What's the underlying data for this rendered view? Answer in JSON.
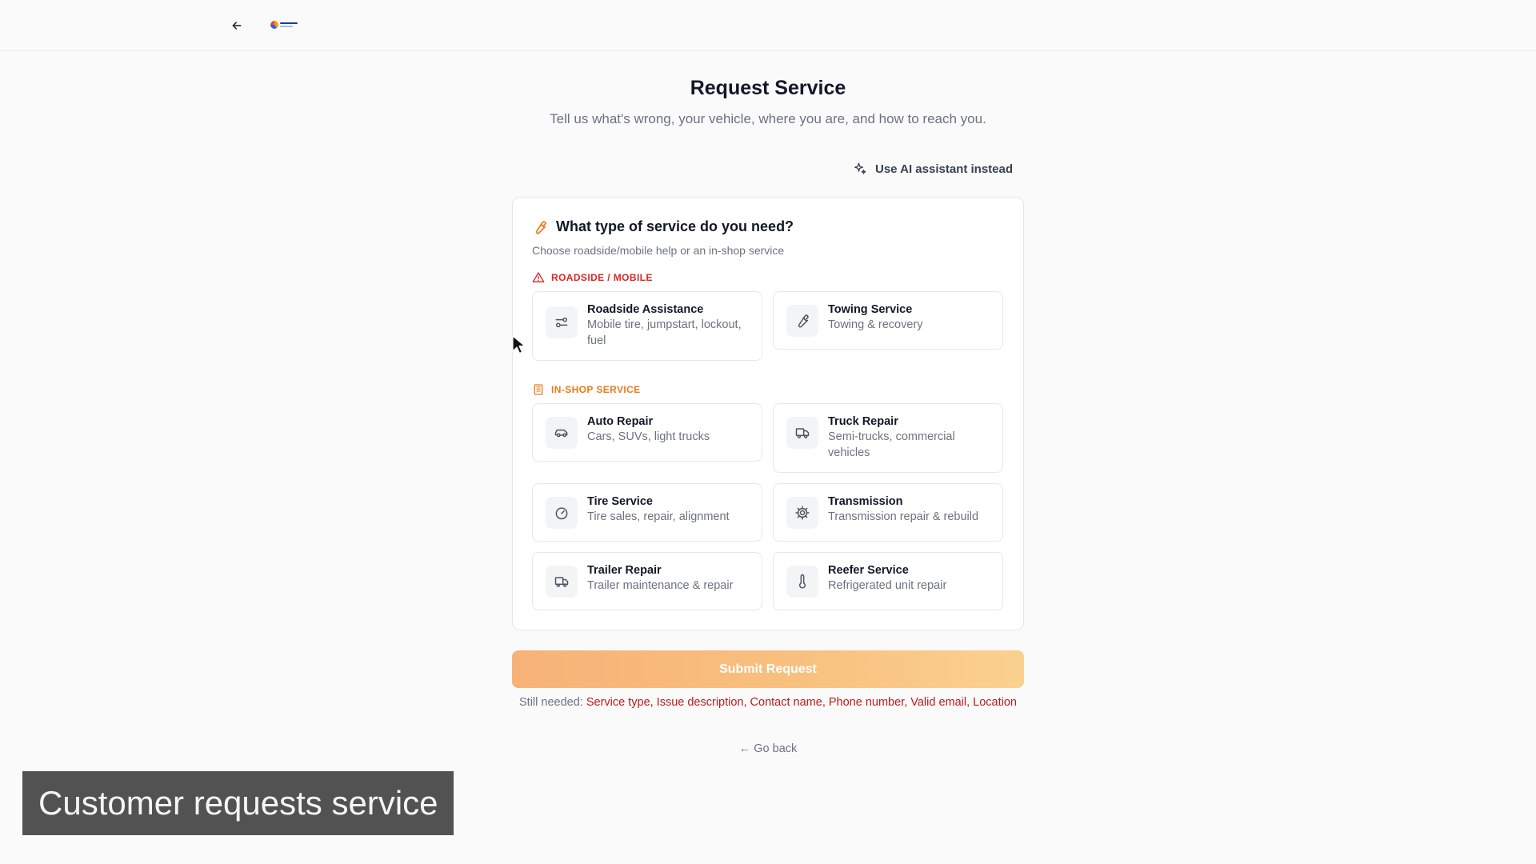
{
  "header": {
    "back_label": "Back",
    "logo_name": "app-logo"
  },
  "page": {
    "title": "Request Service",
    "subtitle": "Tell us what's wrong, your vehicle, where you are, and how to reach you."
  },
  "ai_link": {
    "label": "Use AI assistant instead",
    "icon": "sparkle-icon"
  },
  "service_card": {
    "title": "What type of service do you need?",
    "subtitle": "Choose roadside/mobile help or an in-shop service",
    "title_icon": "wrench-icon",
    "sections": [
      {
        "label": "ROADSIDE / MOBILE",
        "icon": "warning-triangle-icon",
        "color": "#dc2626",
        "options": [
          {
            "name": "Roadside Assistance",
            "desc": "Mobile tire, jumpstart, lockout, fuel",
            "icon": "sliders-icon"
          },
          {
            "name": "Towing Service",
            "desc": "Towing & recovery",
            "icon": "wrench-icon"
          }
        ]
      },
      {
        "label": "IN-SHOP SERVICE",
        "icon": "building-icon",
        "color": "#ea7a1a",
        "options": [
          {
            "name": "Auto Repair",
            "desc": "Cars, SUVs, light trucks",
            "icon": "car-icon"
          },
          {
            "name": "Truck Repair",
            "desc": "Semi-trucks, commercial vehicles",
            "icon": "truck-icon"
          },
          {
            "name": "Tire Service",
            "desc": "Tire sales, repair, alignment",
            "icon": "gauge-icon"
          },
          {
            "name": "Transmission",
            "desc": "Transmission repair & rebuild",
            "icon": "cog-icon"
          },
          {
            "name": "Trailer Repair",
            "desc": "Trailer maintenance & repair",
            "icon": "truck-icon"
          },
          {
            "name": "Reefer Service",
            "desc": "Refrigerated unit repair",
            "icon": "thermometer-icon"
          }
        ]
      }
    ]
  },
  "submit": {
    "label": "Submit Request"
  },
  "validation": {
    "prefix": "Still needed:",
    "missing": "Service type, Issue description, Contact name, Phone number, Valid email, Location"
  },
  "go_back": {
    "label": "← Go back"
  },
  "caption": {
    "text": "Customer requests service"
  },
  "colors": {
    "accent": "#f7b277",
    "danger": "#dc2626",
    "shop": "#ea7a1a"
  }
}
